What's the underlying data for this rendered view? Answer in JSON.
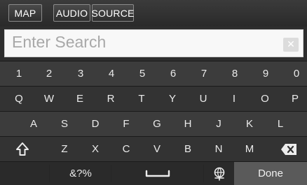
{
  "tabs": [
    "MAP",
    "AUDIO",
    "SOURCE"
  ],
  "search": {
    "placeholder": "Enter Search",
    "clear_label": "✕"
  },
  "rows": {
    "numbers": [
      "1",
      "2",
      "3",
      "4",
      "5",
      "6",
      "7",
      "8",
      "9",
      "0"
    ],
    "top": [
      "Q",
      "W",
      "E",
      "R",
      "T",
      "Y",
      "U",
      "I",
      "O",
      "P"
    ],
    "middle": [
      "A",
      "S",
      "D",
      "F",
      "G",
      "H",
      "J",
      "K",
      "L"
    ],
    "bottom": [
      "Z",
      "X",
      "C",
      "V",
      "B",
      "N",
      "M"
    ]
  },
  "bottom_bar": {
    "symbols_label": "&?%",
    "done_label": "Done"
  },
  "icons": {
    "shift": "shift-icon",
    "backspace": "backspace-icon",
    "space": "space-icon",
    "language": "language-icon"
  },
  "colors": {
    "background": "#2e2e2e",
    "search_bg": "#f8f8f8",
    "done_bg": "#5a5a5a"
  }
}
